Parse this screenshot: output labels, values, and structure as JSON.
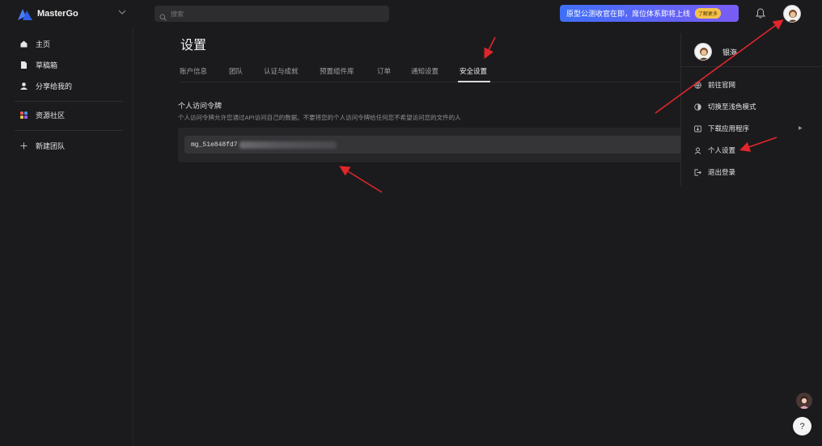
{
  "app": {
    "name": "MasterGo"
  },
  "search": {
    "placeholder": "搜索"
  },
  "promo": {
    "text": "原型公测收官在即，席位体系即将上线",
    "button": "了解更多"
  },
  "sidebar": {
    "items": [
      {
        "label": "主页",
        "icon": "home-icon"
      },
      {
        "label": "草稿箱",
        "icon": "draft-icon"
      },
      {
        "label": "分享给我的",
        "icon": "user-icon"
      },
      {
        "label": "资源社区",
        "icon": "community-icon"
      },
      {
        "label": "新建团队",
        "icon": "plus-icon"
      }
    ]
  },
  "main": {
    "title": "设置",
    "tabs": [
      {
        "label": "账户信息"
      },
      {
        "label": "团队"
      },
      {
        "label": "认证与成就"
      },
      {
        "label": "预置组件库"
      },
      {
        "label": "订单"
      },
      {
        "label": "通知设置"
      },
      {
        "label": "安全设置"
      }
    ],
    "active_tab": "安全设置",
    "section": {
      "title": "个人访问令牌",
      "description": "个人访问令牌允许您通过API访问自己的数据。不要将您的个人访问令牌给任何您不希望访问您的文件的人",
      "token_prefix": "mg_51e848fd7"
    }
  },
  "dropdown": {
    "user_name": "银海",
    "items": [
      {
        "label": "前往官网",
        "icon": "globe-icon"
      },
      {
        "label": "切换至浅色模式",
        "icon": "contrast-icon"
      },
      {
        "label": "下载应用程序",
        "icon": "download-icon",
        "has_submenu": true
      },
      {
        "label": "个人设置",
        "icon": "person-icon"
      },
      {
        "label": "退出登录",
        "icon": "logout-icon"
      }
    ]
  },
  "help": {
    "label": "?"
  },
  "colors": {
    "background": "#1b1b1d",
    "promo_start": "#3f6ff6",
    "promo_end": "#7a5cf5",
    "promo_button": "#f4c24c",
    "annotation_arrow": "#e0262b"
  }
}
